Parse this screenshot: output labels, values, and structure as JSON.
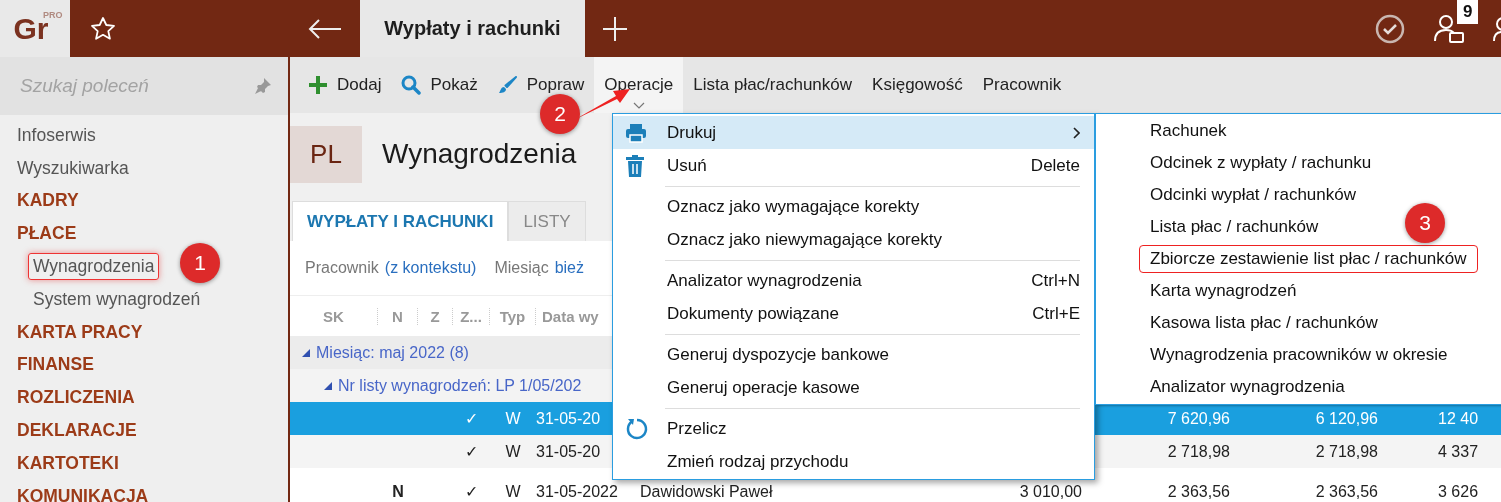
{
  "app": {
    "logo": "Gr",
    "logo_tier": "PRO",
    "tab_title": "Wypłaty i rachunki",
    "notification_count": "9"
  },
  "sidebar": {
    "search_placeholder": "Szukaj poleceń",
    "items": [
      {
        "kind": "link",
        "label": "Infoserwis"
      },
      {
        "kind": "link",
        "label": "Wyszukiwarka"
      },
      {
        "kind": "section",
        "label": "KADRY"
      },
      {
        "kind": "section",
        "label": "PŁACE",
        "children": [
          {
            "label": "Wynagrodzenia",
            "outlined": true
          },
          {
            "label": "System wynagrodzeń",
            "outlined": false
          }
        ]
      },
      {
        "kind": "section",
        "label": "KARTA PRACY"
      },
      {
        "kind": "section",
        "label": "FINANSE"
      },
      {
        "kind": "section",
        "label": "ROZLICZENIA"
      },
      {
        "kind": "section",
        "label": "DEKLARACJE"
      },
      {
        "kind": "section",
        "label": "KARTOTEKI"
      },
      {
        "kind": "section",
        "label": "KOMUNIKACJA"
      }
    ]
  },
  "toolbar": [
    {
      "label": "Dodaj",
      "selected": false
    },
    {
      "label": "Pokaż",
      "selected": false
    },
    {
      "label": "Popraw",
      "selected": false
    },
    {
      "label": "Operacje",
      "selected": true
    },
    {
      "label": "Lista płac/rachunków",
      "selected": false
    },
    {
      "label": "Księgowość",
      "selected": false
    },
    {
      "label": "Pracownik",
      "selected": false
    }
  ],
  "page": {
    "badge": "PL",
    "title": "Wynagrodzenia"
  },
  "tabs": [
    {
      "label": "WYPŁATY I RACHUNKI",
      "selected": true
    },
    {
      "label": "LISTY",
      "selected": false
    }
  ],
  "filters": [
    {
      "label": "Pracownik",
      "value": "(z kontekstu)"
    },
    {
      "label": "Miesiąc",
      "value": "bież"
    }
  ],
  "table": {
    "columns": [
      "SK",
      "N",
      "Z",
      "Z...",
      "Typ",
      "Data wy"
    ],
    "groups": [
      {
        "label": "Miesiąc: maj 2022 (8)"
      },
      {
        "label": "Nr listy wynagrodzeń: LP 1/05/202"
      }
    ],
    "rows": [
      {
        "selected": true,
        "z_status": "✓",
        "type": "W",
        "date": "31-05-20",
        "amount_2": "7 620,96",
        "amount_3": "6 120,96",
        "amount_4": "12 40"
      },
      {
        "selected": false,
        "z_status": "✓",
        "type": "W",
        "date": "31-05-20",
        "amount_2": "2 718,98",
        "amount_3": "2 718,98",
        "amount_4": "4 337"
      },
      {
        "selected": false,
        "n": "N",
        "z_status": "✓",
        "type": "W",
        "date": "31-05-2022",
        "name": "Dawidowski Paweł",
        "amount_1": "3 010,00",
        "amount_2": "2 363,56",
        "amount_3": "2 363,56",
        "amount_4": "3 626"
      }
    ]
  },
  "context_menu": {
    "items": [
      {
        "kind": "item",
        "label": "Drukuj",
        "submenu": true,
        "selected": true
      },
      {
        "kind": "item",
        "label": "Usuń",
        "shortcut": "Delete",
        "selected": false
      },
      {
        "kind": "separator"
      },
      {
        "kind": "item",
        "label": "Oznacz jako wymagające korekty",
        "selected": false
      },
      {
        "kind": "item",
        "label": "Oznacz jako niewymagające korekty",
        "selected": false
      },
      {
        "kind": "separator"
      },
      {
        "kind": "item",
        "label": "Analizator wynagrodzenia",
        "shortcut": "Ctrl+N",
        "selected": false
      },
      {
        "kind": "item",
        "label": "Dokumenty powiązane",
        "shortcut": "Ctrl+E",
        "selected": false
      },
      {
        "kind": "separator"
      },
      {
        "kind": "item",
        "label": "Generuj dyspozycje bankowe",
        "selected": false
      },
      {
        "kind": "item",
        "label": "Generuj operacje kasowe",
        "selected": false
      },
      {
        "kind": "separator"
      },
      {
        "kind": "item",
        "label": "Przelicz",
        "selected": false
      },
      {
        "kind": "item",
        "label": "Zmień rodzaj przychodu",
        "selected": false
      }
    ]
  },
  "submenu": {
    "items": [
      {
        "label": "Rachunek",
        "outlined": false
      },
      {
        "label": "Odcinek z wypłaty / rachunku",
        "outlined": false
      },
      {
        "label": "Odcinki wypłat / rachunków",
        "outlined": false
      },
      {
        "label": "Lista płac / rachunków",
        "outlined": false
      },
      {
        "label": "Zbiorcze zestawienie list płac / rachunków",
        "outlined": true
      },
      {
        "label": "Karta wynagrodzeń",
        "outlined": false
      },
      {
        "label": "Kasowa lista płac / rachunków",
        "outlined": false
      },
      {
        "label": "Wynagrodzenia pracowników w okresie",
        "outlined": false
      },
      {
        "label": "Analizator wynagrodzenia",
        "outlined": false
      }
    ]
  },
  "callouts": [
    {
      "number": "1"
    },
    {
      "number": "2"
    },
    {
      "number": "3"
    }
  ]
}
